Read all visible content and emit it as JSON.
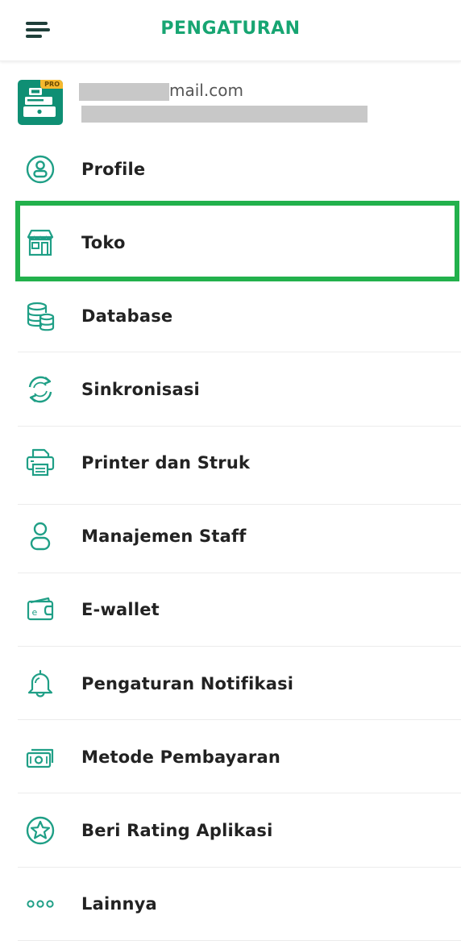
{
  "header": {
    "title": "PENGATURAN",
    "menu_icon": "hamburger-menu-icon"
  },
  "account": {
    "email_suffix": "mail.com",
    "badge": "PRO",
    "avatar_icon": "cash-register-icon"
  },
  "menu": {
    "items": [
      {
        "label": "Profile",
        "icon": "profile-icon"
      },
      {
        "label": "Toko",
        "icon": "store-icon"
      },
      {
        "label": "Database",
        "icon": "database-icon"
      },
      {
        "label": "Sinkronisasi",
        "icon": "sync-icon"
      },
      {
        "label": "Printer dan Struk",
        "icon": "printer-icon"
      },
      {
        "label": "Manajemen Staff",
        "icon": "staff-icon"
      },
      {
        "label": "E-wallet",
        "icon": "wallet-icon"
      },
      {
        "label": "Pengaturan Notifikasi",
        "icon": "bell-icon"
      },
      {
        "label": "Metode Pembayaran",
        "icon": "money-icon"
      },
      {
        "label": "Beri Rating Aplikasi",
        "icon": "star-icon"
      },
      {
        "label": "Lainnya",
        "icon": "more-dots-icon"
      }
    ]
  },
  "colors": {
    "accent": "#17a572",
    "icon": "#1f9f86",
    "highlight": "#22b14c",
    "avatar_bg": "#0f8f74",
    "badge": "#f5b82e"
  }
}
